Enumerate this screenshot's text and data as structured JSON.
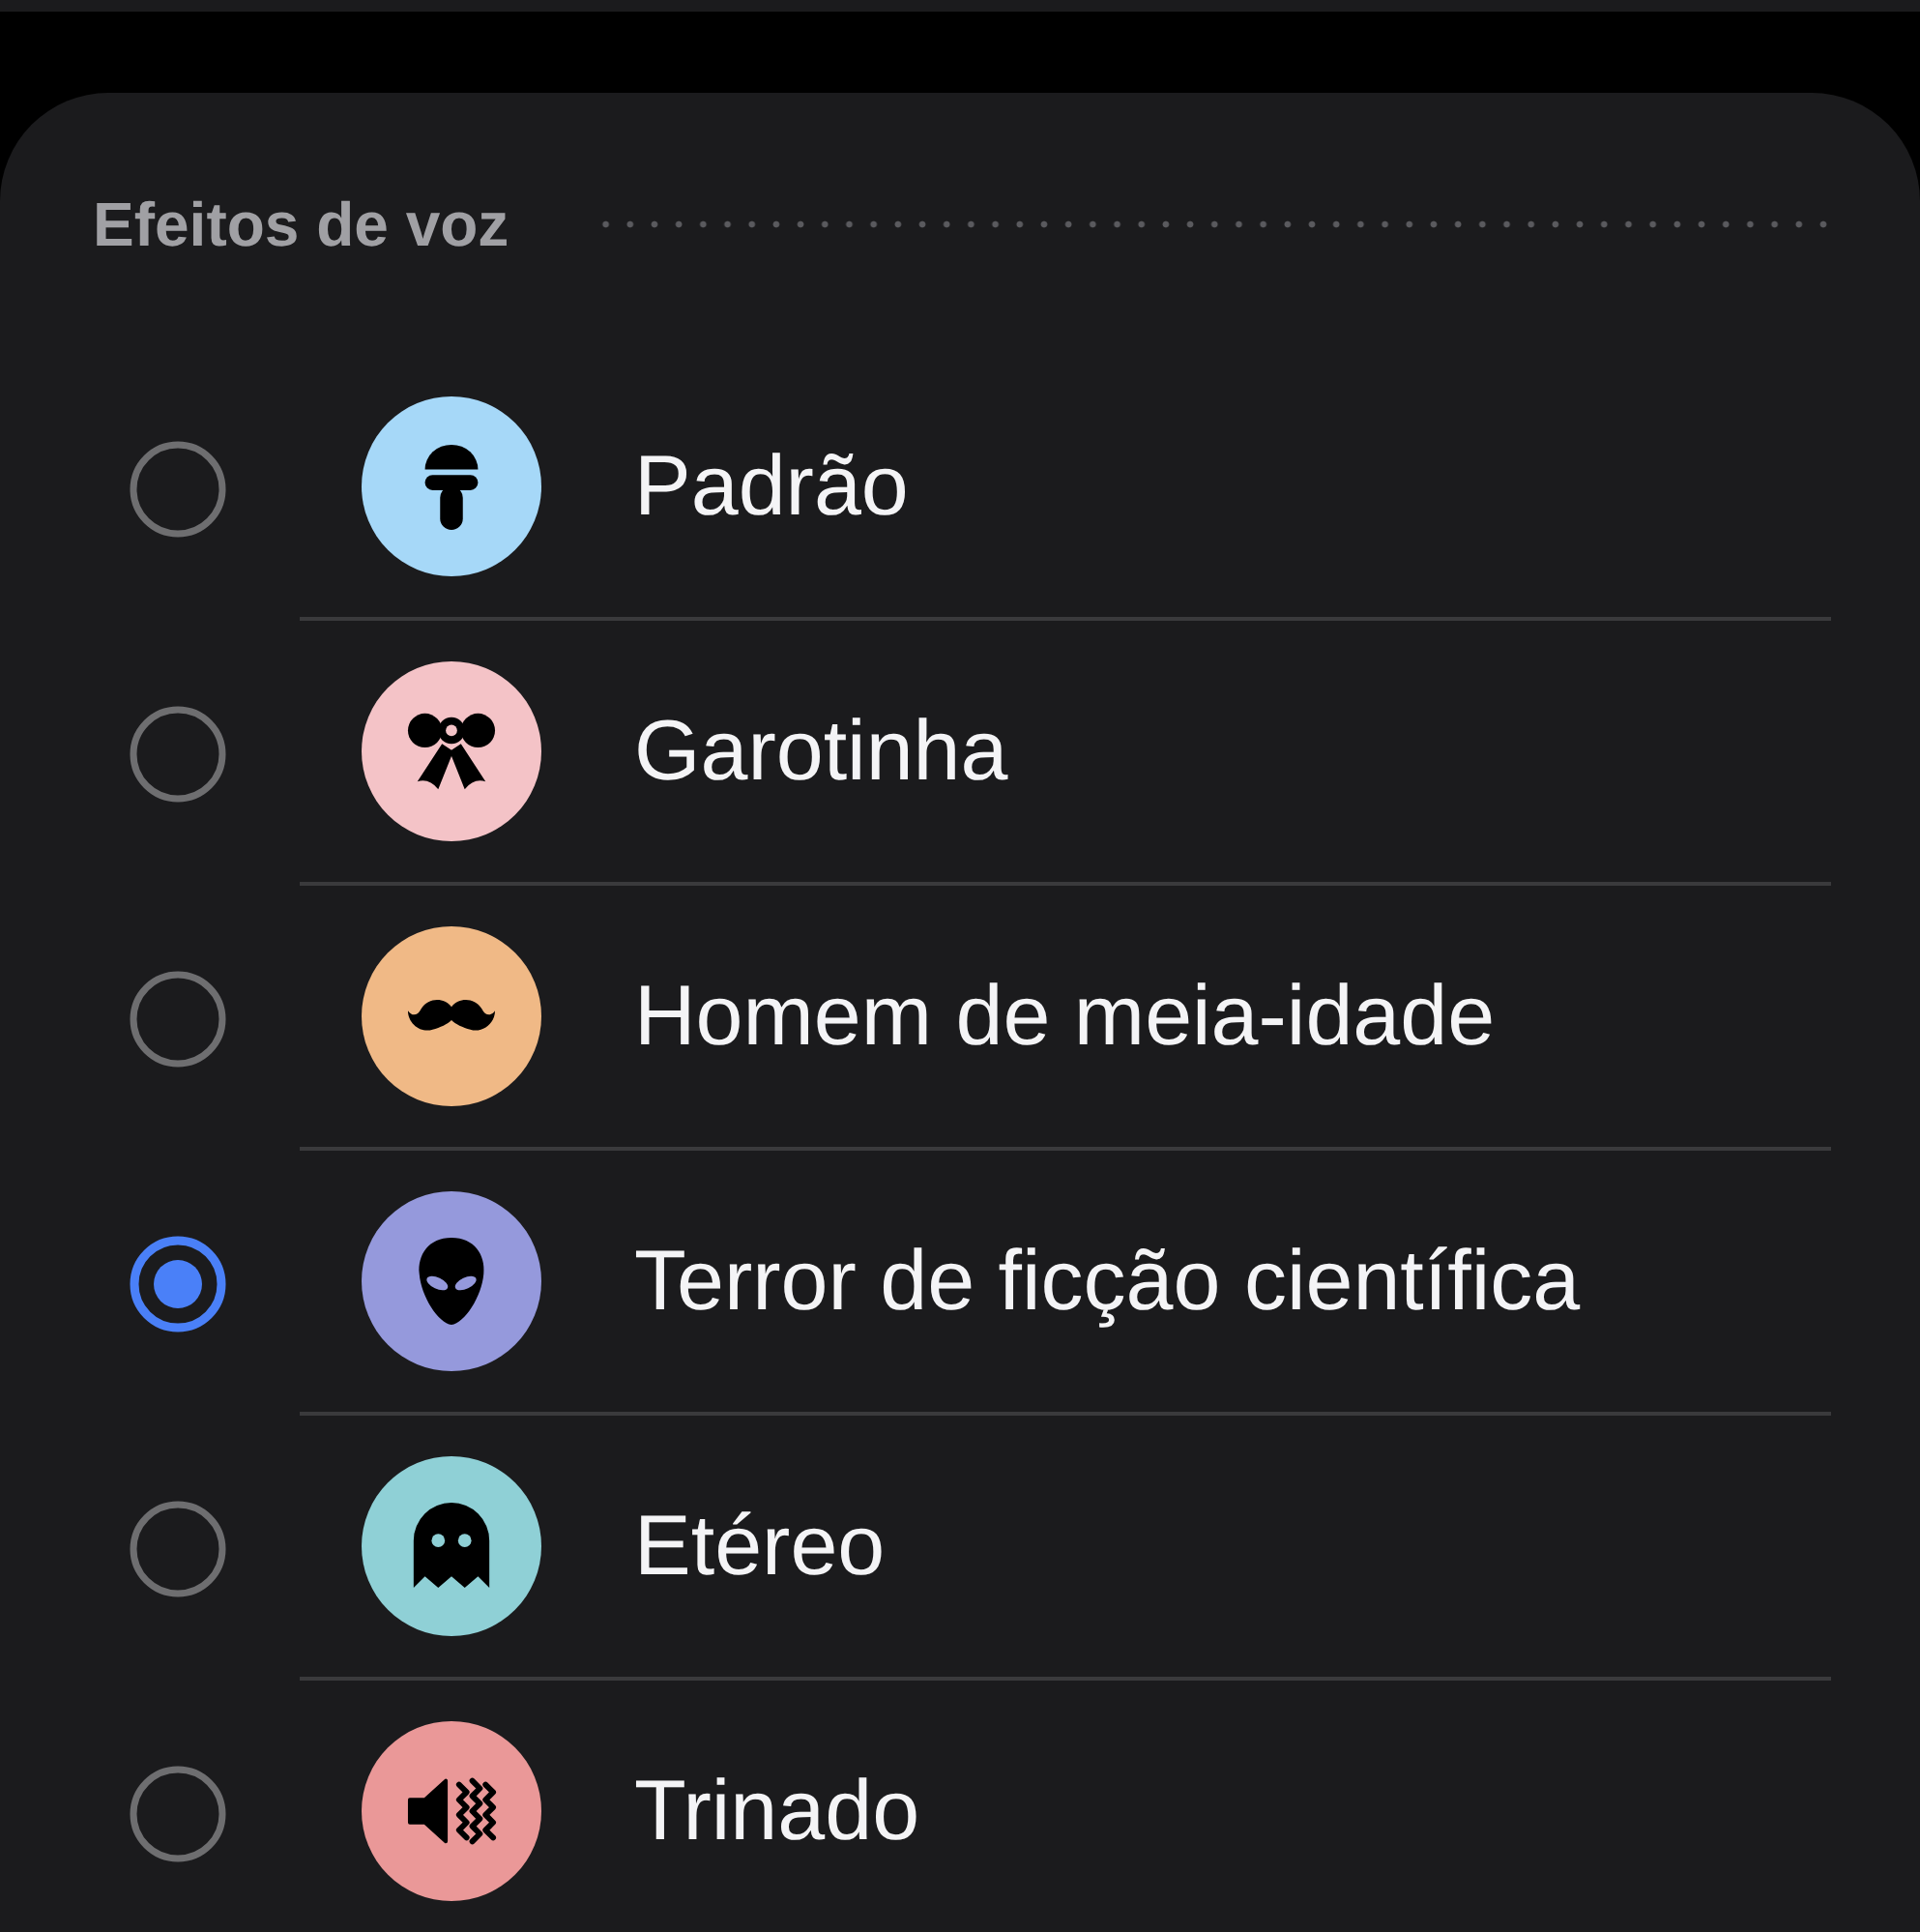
{
  "section": {
    "title": "Efeitos de voz"
  },
  "effects": [
    {
      "name": "Padrão",
      "color": "#a6d8f8",
      "selected": false
    },
    {
      "name": "Garotinha",
      "color": "#f4c3c7",
      "selected": false
    },
    {
      "name": "Homem de meia-idade",
      "color": "#f0b986",
      "selected": false
    },
    {
      "name": "Terror de ficção científica",
      "color": "#9599dc",
      "selected": true
    },
    {
      "name": "Etéreo",
      "color": "#8fd0d6",
      "selected": false
    },
    {
      "name": "Trinado",
      "color": "#ea9898",
      "selected": false
    }
  ]
}
